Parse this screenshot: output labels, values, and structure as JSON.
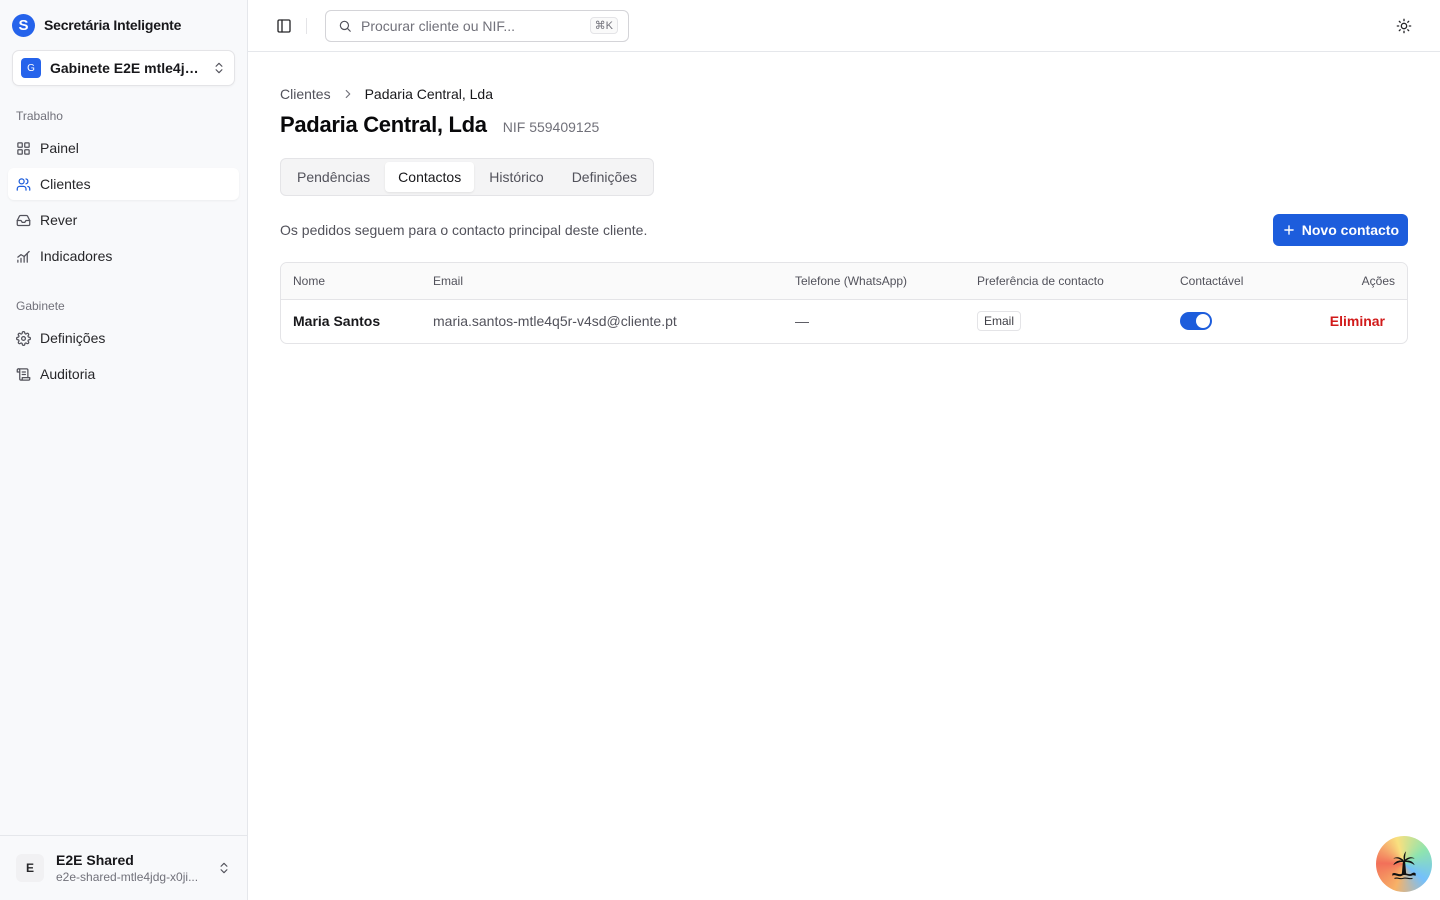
{
  "sidebar": {
    "brand": {
      "letter": "S",
      "name": "Secretária Inteligente"
    },
    "org": {
      "badge": "G",
      "name": "Gabinete E2E mtle4jd..."
    },
    "sections": [
      {
        "label": "Trabalho",
        "items": [
          {
            "label": "Painel",
            "icon": "grid-icon",
            "active": false
          },
          {
            "label": "Clientes",
            "icon": "users-icon",
            "active": true
          },
          {
            "label": "Rever",
            "icon": "inbox-icon",
            "active": false
          },
          {
            "label": "Indicadores",
            "icon": "chart-icon",
            "active": false
          }
        ]
      },
      {
        "label": "Gabinete",
        "items": [
          {
            "label": "Definições",
            "icon": "gear-icon",
            "active": false
          },
          {
            "label": "Auditoria",
            "icon": "scroll-icon",
            "active": false
          }
        ]
      }
    ],
    "user": {
      "initial": "E",
      "name": "E2E Shared",
      "email": "e2e-shared-mtle4jdg-x0ji..."
    }
  },
  "topbar": {
    "search_placeholder": "Procurar cliente ou NIF...",
    "shortcut": "⌘K"
  },
  "breadcrumb": {
    "parent": "Clientes",
    "current": "Padaria Central, Lda"
  },
  "page": {
    "title": "Padaria Central, Lda",
    "nif": "NIF 559409125"
  },
  "tabs": [
    {
      "label": "Pendências",
      "active": false
    },
    {
      "label": "Contactos",
      "active": true
    },
    {
      "label": "Histórico",
      "active": false
    },
    {
      "label": "Definições",
      "active": false
    }
  ],
  "contacts": {
    "info": "Os pedidos seguem para o contacto principal deste cliente.",
    "new_button": "Novo contacto",
    "columns": [
      "Nome",
      "Email",
      "Telefone (WhatsApp)",
      "Preferência de contacto",
      "Contactável",
      "Ações"
    ],
    "rows": [
      {
        "name": "Maria Santos",
        "email": "maria.santos-mtle4q5r-v4sd@cliente.pt",
        "phone": "—",
        "preference": "Email",
        "contactable": true,
        "action": "Eliminar"
      }
    ]
  },
  "colors": {
    "accent": "#1d5ddc",
    "danger": "#d11a1a",
    "sidebar_bg": "#f8f9fb"
  }
}
